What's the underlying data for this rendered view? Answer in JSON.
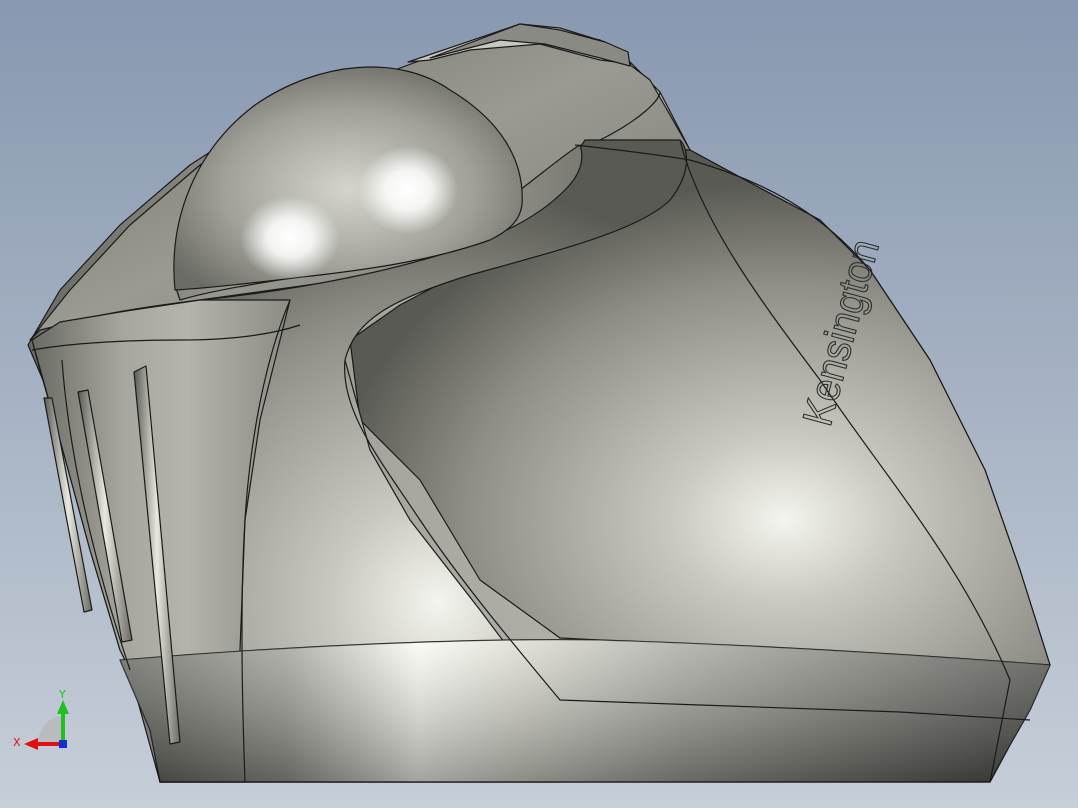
{
  "viewport": {
    "background_top": "#8a9cb2",
    "background_bottom": "#c4ccd6",
    "edge_color": "#1a1a1a"
  },
  "model": {
    "body_color": "#a8a8a0",
    "ball_color": "#b8b8b0",
    "logo_text": "Kensington"
  },
  "triad": {
    "x_label": "X",
    "y_label": "Y",
    "x_color": "#e01010",
    "y_color": "#20c020",
    "z_color": "#1030d0"
  }
}
